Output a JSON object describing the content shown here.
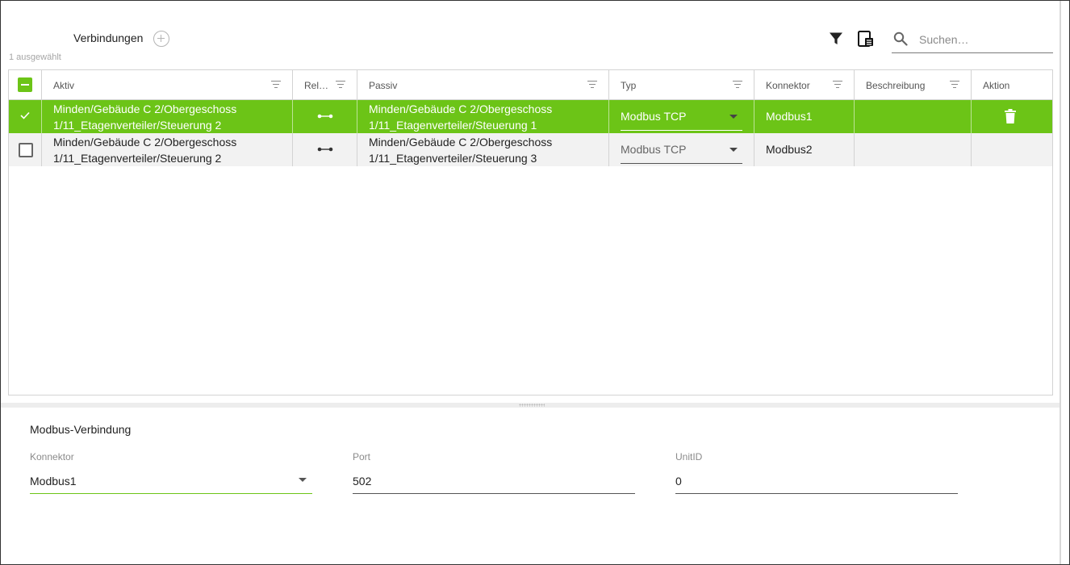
{
  "header": {
    "title": "Verbindungen",
    "selected_count": "1 ausgewählt",
    "search_placeholder": "Suchen…"
  },
  "grid": {
    "columns": {
      "aktiv": "Aktiv",
      "relation": "Rel…",
      "passiv": "Passiv",
      "typ": "Typ",
      "konnektor": "Konnektor",
      "beschreibung": "Beschreibung",
      "aktion": "Aktion"
    },
    "rows": [
      {
        "selected": true,
        "aktiv_line1": "Minden/Gebäude C 2/Obergeschoss",
        "aktiv_line2": "1/11_Etagenverteiler/Steuerung 2",
        "passiv_line1": "Minden/Gebäude C 2/Obergeschoss",
        "passiv_line2": "1/11_Etagenverteiler/Steuerung 1",
        "typ": "Modbus TCP",
        "konnektor": "Modbus1",
        "beschreibung": ""
      },
      {
        "selected": false,
        "aktiv_line1": "Minden/Gebäude C 2/Obergeschoss",
        "aktiv_line2": "1/11_Etagenverteiler/Steuerung 2",
        "passiv_line1": "Minden/Gebäude C 2/Obergeschoss",
        "passiv_line2": "1/11_Etagenverteiler/Steuerung 3",
        "typ": "Modbus TCP",
        "konnektor": "Modbus2",
        "beschreibung": ""
      }
    ]
  },
  "detail": {
    "section_title": "Modbus-Verbindung",
    "konnektor_label": "Konnektor",
    "konnektor_value": "Modbus1",
    "port_label": "Port",
    "port_value": "502",
    "unitid_label": "UnitID",
    "unitid_value": "0"
  },
  "colors": {
    "accent": "#6cc417",
    "selected_row": "#6cc417",
    "alt_row": "#f2f2f2"
  },
  "icons": [
    "add-circle-icon",
    "filter-icon",
    "column-chooser-icon",
    "search-icon",
    "column-filter-icon",
    "checkbox-icon",
    "relation-icon",
    "dropdown-caret-icon",
    "trash-icon",
    "resize-grip-icon"
  ]
}
